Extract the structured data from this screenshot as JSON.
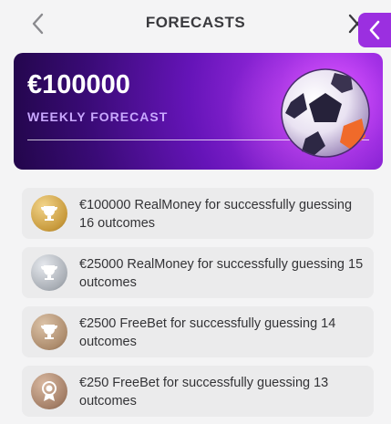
{
  "header": {
    "title": "FORECASTS",
    "back_icon": "chevron-left-icon",
    "close_icon": "close-icon",
    "side_tab_icon": "chevron-left-icon"
  },
  "banner": {
    "amount": "€100000",
    "subtitle": "WEEKLY FORECAST",
    "image": "soccer-ball"
  },
  "prizes": [
    {
      "text": "€100000 RealMoney for successfully guessing 16 outcomes",
      "medal": "gold-trophy-icon",
      "color": "#c89a3c"
    },
    {
      "text": "€25000 RealMoney for successfully guessing 15 outcomes",
      "medal": "silver-trophy-icon",
      "color": "#a9aeb5"
    },
    {
      "text": "€2500 FreeBet for successfully guessing 14 outcomes",
      "medal": "bronze-trophy-icon",
      "color": "#ad8c6d"
    },
    {
      "text": "€250 FreeBet for successfully guessing 13 outcomes",
      "medal": "medal-icon",
      "color": "#a47f67"
    }
  ],
  "colors": {
    "accent": "#9b2fe0",
    "background": "#f4f4f5",
    "card": "#ebebec"
  }
}
